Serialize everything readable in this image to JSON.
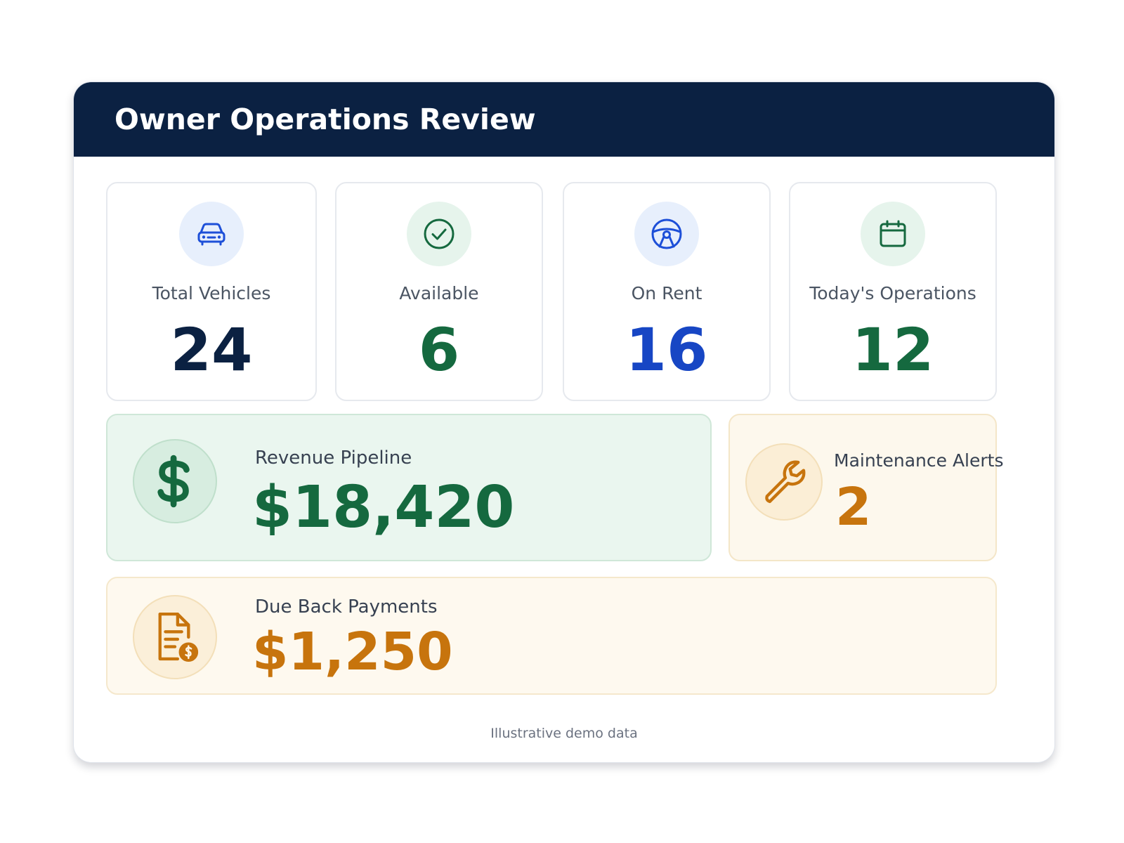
{
  "header": {
    "title": "Owner Operations Review"
  },
  "stats": [
    {
      "label": "Total Vehicles",
      "value": "24",
      "icon": "car-icon",
      "color": "#0b2142",
      "tint": "#e7effc"
    },
    {
      "label": "Available",
      "value": "6",
      "icon": "check-circle-icon",
      "color": "#15693f",
      "tint": "#e6f4ec"
    },
    {
      "label": "On Rent",
      "value": "16",
      "icon": "steering-wheel-icon",
      "color": "#1746c4",
      "tint": "#e7effc"
    },
    {
      "label": "Today's Operations",
      "value": "12",
      "icon": "calendar-icon",
      "color": "#15693f",
      "tint": "#e6f4ec"
    }
  ],
  "revenue": {
    "label": "Revenue Pipeline",
    "value": "$18,420",
    "icon": "dollar-icon",
    "color": "#15693f"
  },
  "maintenance": {
    "label": "Maintenance Alerts",
    "value": "2",
    "icon": "wrench-icon",
    "color": "#c7740d"
  },
  "due_back": {
    "label": "Due Back Payments",
    "value": "$1,250",
    "icon": "invoice-dollar-icon",
    "color": "#c7740d"
  },
  "footer": {
    "note": "Illustrative demo data"
  }
}
